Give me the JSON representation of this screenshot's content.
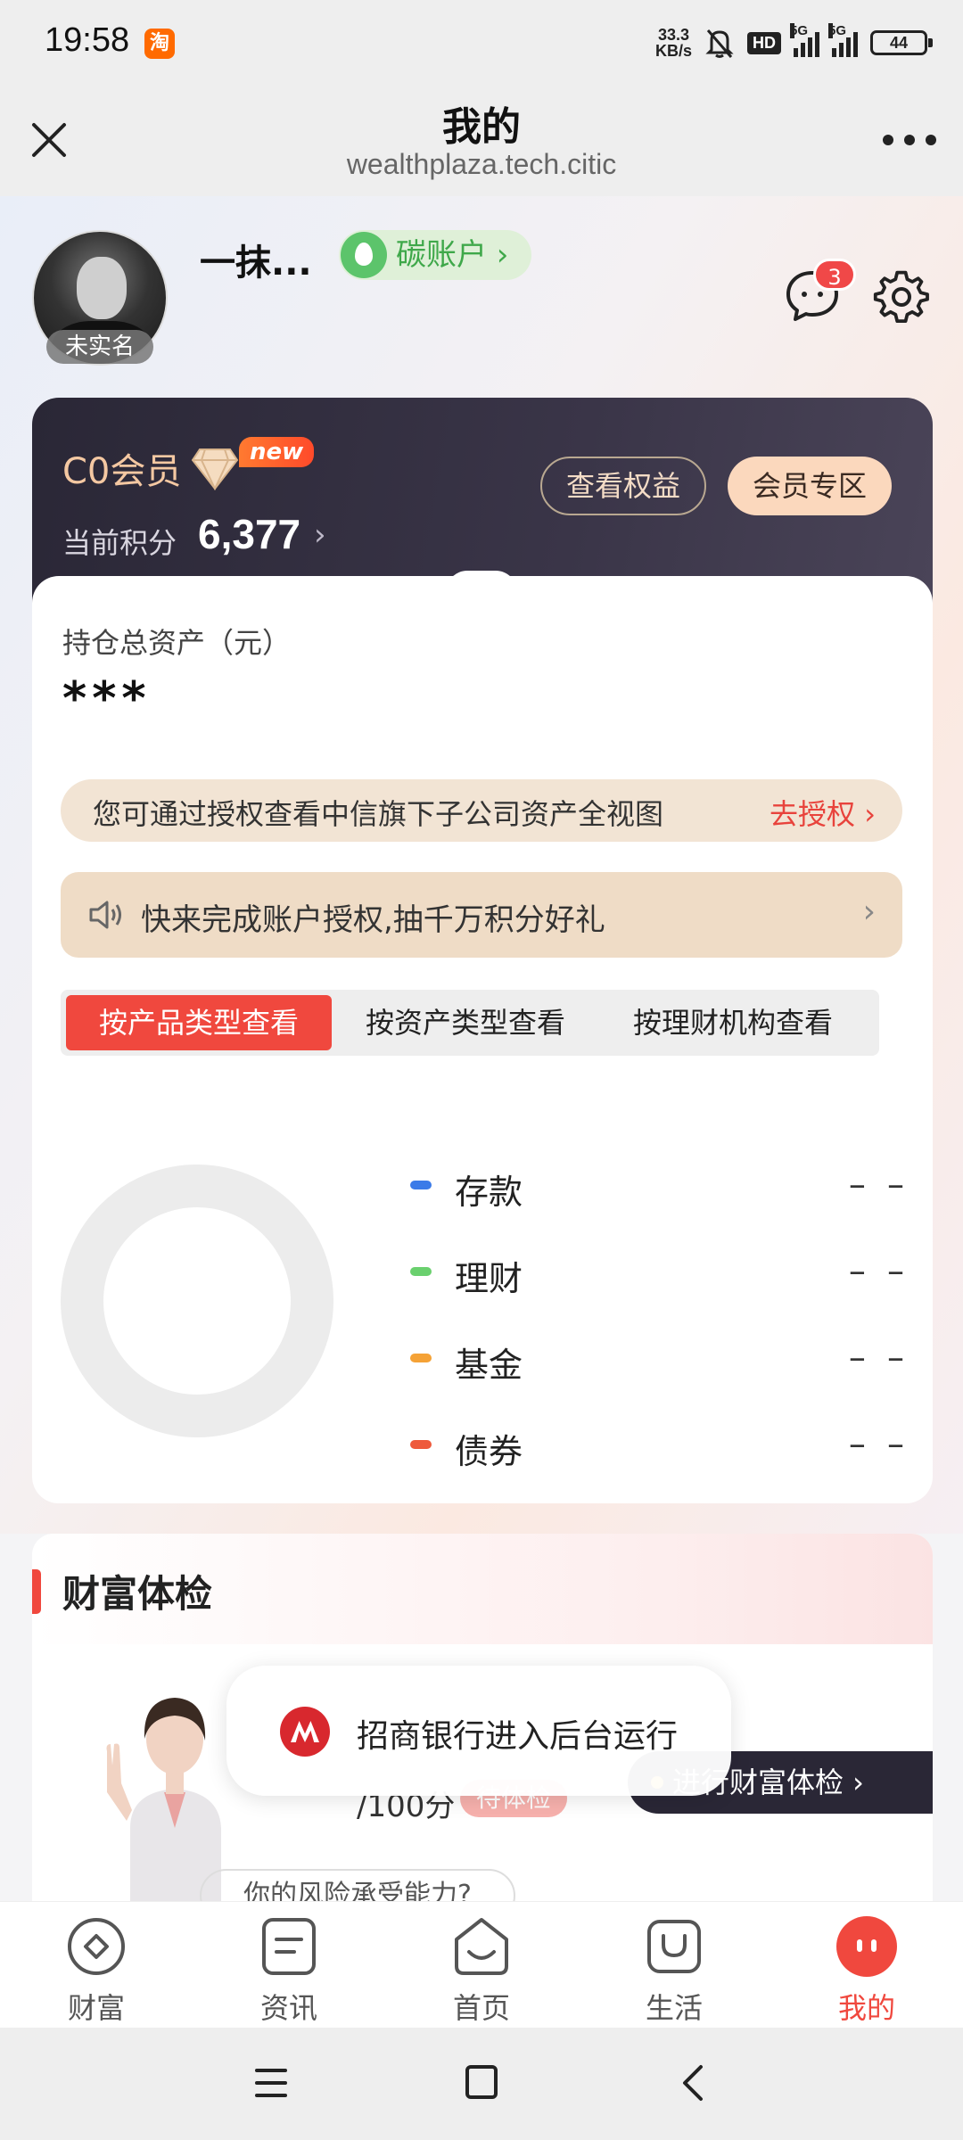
{
  "status_bar": {
    "time": "19:58",
    "app_badge": "淘",
    "net_speed_top": "33.3",
    "net_speed_bottom": "KB/s",
    "hd": "HD",
    "sim1": "5G",
    "sim2": "5G",
    "battery": "44"
  },
  "titlebar": {
    "title": "我的",
    "url": "wealthplaza.tech.citic"
  },
  "profile": {
    "username": "一抹...",
    "verify_badge": "未实名",
    "carbon_account": "碳账户 ›",
    "message_count": "3"
  },
  "member": {
    "level": "C0会员",
    "new_tag": "new",
    "points_label": "当前积分",
    "points": "6,377",
    "points_arrow": "›",
    "view_benefits": "查看权益",
    "member_zone": "会员专区"
  },
  "assets": {
    "title": "持仓总资产（元）",
    "value": "***",
    "auth_text": "您可通过授权查看中信旗下子公司资产全视图",
    "auth_link": "去授权 ›",
    "promo_text": "快来完成账户授权,抽千万积分好礼",
    "promo_arrow": "›",
    "tabs": [
      "按产品类型查看",
      "按资产类型查看",
      "按理财机构查看"
    ],
    "legend": [
      {
        "label": "存款",
        "value": "– –",
        "color": "#3b7be8"
      },
      {
        "label": "理财",
        "value": "– –",
        "color": "#6ad06e"
      },
      {
        "label": "基金",
        "value": "– –",
        "color": "#f5a236"
      },
      {
        "label": "债券",
        "value": "– –",
        "color": "#ee5a3c"
      }
    ]
  },
  "wealth_check": {
    "title": "财富体检",
    "score": "/100分",
    "pending": "待体检",
    "button": "进行财富体检 ›",
    "risk_question": "你的风险承受能力?"
  },
  "toast": {
    "text": "招商银行进入后台运行"
  },
  "bottom_nav": [
    {
      "label": "财富",
      "icon": "wealth-icon"
    },
    {
      "label": "资讯",
      "icon": "news-icon"
    },
    {
      "label": "首页",
      "icon": "home-icon"
    },
    {
      "label": "生活",
      "icon": "life-icon"
    },
    {
      "label": "我的",
      "icon": "mine-icon"
    }
  ],
  "colors": {
    "accent": "#f0483e",
    "member_card": "#2a2736",
    "member_gold": "#f4c8a2"
  }
}
